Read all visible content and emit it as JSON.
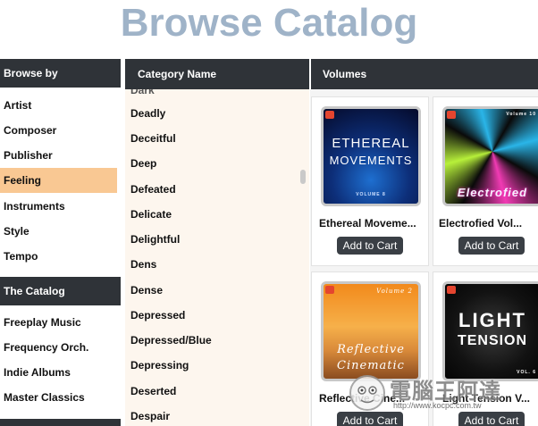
{
  "page": {
    "title": "Browse Catalog"
  },
  "left": {
    "browse_header": "Browse by",
    "browse_items": [
      "Artist",
      "Composer",
      "Publisher",
      "Feeling",
      "Instruments",
      "Style",
      "Tempo"
    ],
    "selected_index": 3,
    "catalog_header": "The Catalog",
    "catalog_items": [
      "Freeplay Music",
      "Frequency Orch.",
      "Indie Albums",
      "Master Classics"
    ]
  },
  "category": {
    "header": "Category Name",
    "items": [
      "Deadly",
      "Deceitful",
      "Deep",
      "Defeated",
      "Delicate",
      "Delightful",
      "Dens",
      "Dense",
      "Depressed",
      "Depressed/Blue",
      "Depressing",
      "Deserted",
      "Despair"
    ]
  },
  "volumes": {
    "header": "Volumes",
    "cards": [
      {
        "title": "Ethereal Moveme...",
        "cover_line1": "ETHEREAL",
        "cover_line2": "MOVEMENTS",
        "cover_volume": "VOLUME 8",
        "button": "Add to Cart"
      },
      {
        "title": "Electrofied Vol...",
        "cover_line1": "Electrofied",
        "cover_volume": "Volume 10",
        "button": "Add to Cart"
      },
      {
        "title": "Reflective Cine...",
        "cover_line1": "Reflective",
        "cover_line2": "Cinematic",
        "cover_volume": "Volume 2",
        "button": "Add to Cart"
      },
      {
        "title": "Light Tension V...",
        "cover_line1": "LIGHT",
        "cover_line2": "TENSION",
        "cover_volume": "VOL. 6",
        "button": "Add to Cart"
      }
    ]
  },
  "watermark": {
    "text": "電腦王阿達",
    "url": "http://www.kocpc.com.tw"
  },
  "colors": {
    "header_bg": "#2f3338",
    "selected_bg": "#f9c893",
    "title_color": "#9fb3c8",
    "category_bg": "#fdf6ee"
  }
}
